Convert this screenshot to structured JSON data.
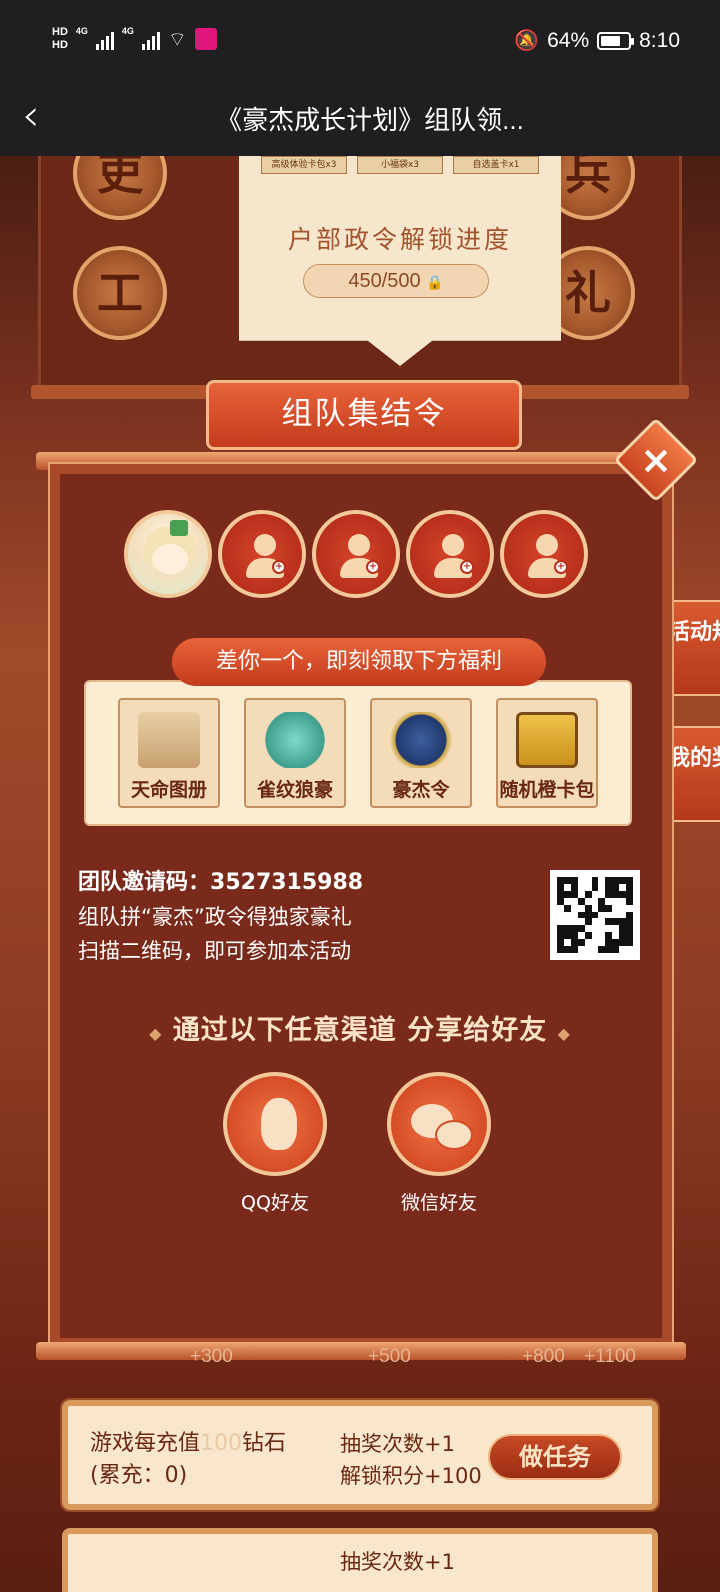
{
  "status_bar": {
    "hd1": "HD",
    "hd2": "HD",
    "net1": "4G",
    "net2": "4G",
    "battery_pct": "64%",
    "battery_level": 0.64,
    "time": "8:10"
  },
  "nav": {
    "back": "‹",
    "title": "《豪杰成长计划》组队领..."
  },
  "background": {
    "medals": [
      "吏",
      "兵",
      "工",
      "礼"
    ],
    "reward_tags": [
      "高级体验卡包x3",
      "小福袋x3",
      "自选盖卡x1"
    ],
    "unlock_title": "户部政令解锁进度",
    "unlock_progress": "450/500"
  },
  "banner": "组队集结令",
  "side": {
    "rules": "活动规则",
    "prizes": "我的奖品"
  },
  "dialog": {
    "close": "×",
    "promo": "差你一个，即刻领取下方福利",
    "benefits": [
      "天命图册",
      "雀纹狼豪",
      "豪杰令",
      "随机橙卡包"
    ],
    "invite_code_label": "团队邀请码：",
    "invite_code": "3527315988",
    "line1": "组队拼“豪杰”政令得独家豪礼",
    "line2": "扫描二维码，即可参加本活动",
    "share_title": "通过以下任意渠道 分享给好友",
    "share_qq": "QQ好友",
    "share_wechat": "微信好友"
  },
  "milestones": [
    "+300",
    "+500",
    "+800",
    "+1100"
  ],
  "task": {
    "desc_prefix": "游戏每充值",
    "desc_num": "100",
    "desc_suffix": "钻石",
    "desc_line2": "(累充：0)",
    "reward1": "抽奖次数+1",
    "reward2": "解锁积分+100",
    "button": "做任务"
  },
  "task2": {
    "reward1": "抽奖次数+1"
  },
  "colors": {
    "accent": "#c33b1c",
    "panel": "#7a2a1a",
    "paper": "#f6e6cc"
  }
}
